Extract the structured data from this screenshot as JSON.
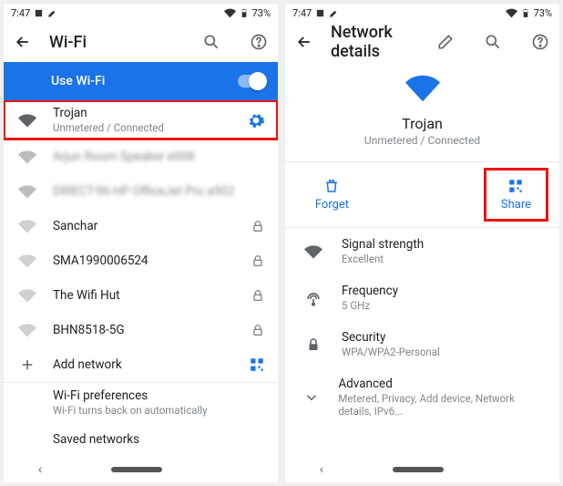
{
  "statusbar": {
    "time": "7:47",
    "battery": "73%"
  },
  "left": {
    "title": "Wi-Fi",
    "toggle_label": "Use Wi-Fi",
    "connected": {
      "name": "Trojan",
      "sub": "Unmetered / Connected"
    },
    "networks": [
      {
        "name": "Arjun Room Speaker e008",
        "locked": false,
        "blur": true
      },
      {
        "name": "DIRECT-96-HP OfficeJet Pro a902",
        "locked": false,
        "blur": true
      },
      {
        "name": "Sanchar",
        "locked": true,
        "blur": false
      },
      {
        "name": "SMA1990006524",
        "locked": true,
        "blur": false
      },
      {
        "name": "The Wifi Hut",
        "locked": true,
        "blur": false
      },
      {
        "name": "BHN8518-5G",
        "locked": true,
        "blur": false
      }
    ],
    "add_label": "Add network",
    "prefs": {
      "label": "Wi-Fi preferences",
      "sub": "Wi-Fi turns back on automatically"
    },
    "saved_label": "Saved networks"
  },
  "right": {
    "title": "Network details",
    "network": {
      "name": "Trojan",
      "sub": "Unmetered / Connected"
    },
    "actions": {
      "forget": "Forget",
      "share": "Share"
    },
    "details": {
      "signal": {
        "label": "Signal strength",
        "value": "Excellent"
      },
      "freq": {
        "label": "Frequency",
        "value": "5 GHz"
      },
      "security": {
        "label": "Security",
        "value": "WPA/WPA2-Personal"
      },
      "advanced": {
        "label": "Advanced",
        "value": "Metered, Privacy, Add device, Network details, IPv6..."
      }
    }
  }
}
